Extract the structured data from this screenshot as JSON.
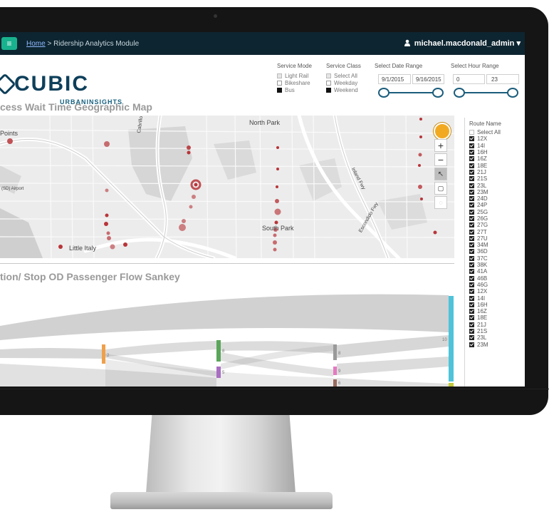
{
  "topbar": {
    "home_link": "Home",
    "breadcrumb_rest": " > Ridership Analytics Module",
    "user_name": "michael.macdonald_admin",
    "user_caret": "▾"
  },
  "logo": {
    "name": "CUBIC",
    "tagline": "URBANINSIGHTS"
  },
  "map_section": {
    "title": "cess Wait Time Geographic Map",
    "labels": {
      "north_park": "North Park",
      "south_park": "South Park",
      "little_italy": "Little Italy",
      "airport": "(SD) Airport",
      "points": "Points",
      "cabrillo": "Cabrillo Fwy",
      "inland": "Inland Fwy",
      "escondido": "Escondido Fwy"
    },
    "zoom_in": "+",
    "zoom_out": "−"
  },
  "sankey_section": {
    "title": "tion/ Stop OD Passenger Flow Sankey",
    "node_labels": [
      "2",
      "8",
      "5",
      "8",
      "9",
      "6",
      "10"
    ]
  },
  "filters": {
    "service_mode": {
      "title": "Service Mode",
      "options": [
        {
          "label": "Light Rail",
          "state": "grey"
        },
        {
          "label": "Bikeshare",
          "state": "empty"
        },
        {
          "label": "Bus",
          "state": "filled"
        }
      ]
    },
    "service_class": {
      "title": "Service Class",
      "options": [
        {
          "label": "Select All",
          "state": "grey"
        },
        {
          "label": "Weekday",
          "state": "empty"
        },
        {
          "label": "Weekend",
          "state": "filled"
        }
      ]
    },
    "date_range": {
      "title": "Select Date Range",
      "start": "9/1/2015",
      "end": "9/16/2015"
    },
    "hour_range": {
      "title": "Select Hour Range",
      "start": "0",
      "end": "23"
    }
  },
  "routes": {
    "title": "Route Name",
    "select_all": "Select All",
    "items": [
      "12X",
      "14I",
      "16H",
      "16Z",
      "18E",
      "21J",
      "21S",
      "23L",
      "23M",
      "24D",
      "24P",
      "25G",
      "26G",
      "27G",
      "27T",
      "27U",
      "34M",
      "36D",
      "37C",
      "38K",
      "41A",
      "46B",
      "46G",
      "12X",
      "14I",
      "16H",
      "16Z",
      "18E",
      "21J",
      "21S",
      "23L",
      "23M"
    ]
  },
  "colors": {
    "topbar": "#0d2530",
    "accent_green": "#19b28e",
    "brand_blue": "#0d3f5a",
    "map_dot": "#b8353a",
    "sankey_grey": "#9a9a9a",
    "node_cyan": "#4fc3d9",
    "node_orange": "#f0a04b",
    "node_green": "#5aa65a",
    "node_purple": "#a86fc2",
    "node_pink": "#e57ac2",
    "node_brown": "#9a6b5e"
  }
}
